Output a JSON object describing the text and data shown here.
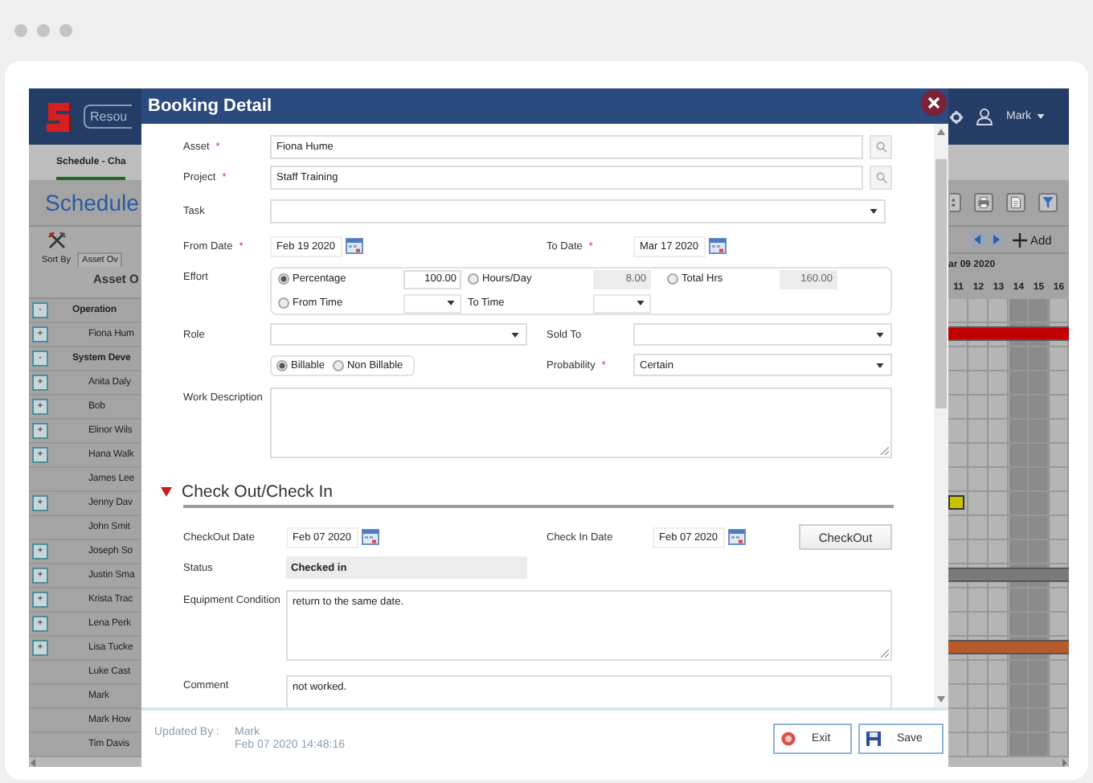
{
  "app": {
    "resource_button": "Resou",
    "user": "Mark"
  },
  "page_tab": {
    "label": "Schedule - Cha",
    "selected": true
  },
  "page_title": "Schedule",
  "grid_header": {
    "sort_label": "Sort By",
    "sort_tab": "Asset Ov",
    "column_heading": "Asset O",
    "add_label": "Add",
    "week": "ar 09 2020"
  },
  "days": [
    {
      "label": "11",
      "weekend": false
    },
    {
      "label": "12",
      "weekend": false
    },
    {
      "label": "13",
      "weekend": false
    },
    {
      "label": "14",
      "weekend": true
    },
    {
      "label": "15",
      "weekend": true
    },
    {
      "label": "16",
      "weekend": false
    }
  ],
  "rows": [
    {
      "kind": "group",
      "toggle": "-",
      "name": "Operation"
    },
    {
      "kind": "asset",
      "toggle": "+",
      "name": "Fiona Hum",
      "bar": {
        "kind": "span",
        "color": "#c00000"
      }
    },
    {
      "kind": "group",
      "toggle": "-",
      "name": "System Deve"
    },
    {
      "kind": "asset",
      "toggle": "+",
      "name": "Anita Daly"
    },
    {
      "kind": "asset",
      "toggle": "+",
      "name": "Bob"
    },
    {
      "kind": "asset",
      "toggle": "+",
      "name": "Elinor Wils"
    },
    {
      "kind": "asset",
      "toggle": "+",
      "name": "Hana Walk"
    },
    {
      "kind": "asset",
      "name": "James Lee"
    },
    {
      "kind": "asset",
      "toggle": "+",
      "name": "Jenny Dav",
      "bar": {
        "kind": "marker",
        "color": "#c8c400"
      }
    },
    {
      "kind": "asset",
      "name": "John Smit"
    },
    {
      "kind": "asset",
      "toggle": "+",
      "name": "Joseph So"
    },
    {
      "kind": "asset",
      "toggle": "+",
      "name": "Justin Sma",
      "bar": {
        "kind": "span",
        "color": "#7a7a7a"
      }
    },
    {
      "kind": "asset",
      "toggle": "+",
      "name": "Krista Trac"
    },
    {
      "kind": "asset",
      "toggle": "+",
      "name": "Lena Perk"
    },
    {
      "kind": "asset",
      "toggle": "+",
      "name": "Lisa Tucke",
      "bar": {
        "kind": "span",
        "color": "#b85a2a"
      }
    },
    {
      "kind": "asset",
      "name": "Luke Cast"
    },
    {
      "kind": "asset",
      "name": "Mark"
    },
    {
      "kind": "asset",
      "name": "Mark How"
    },
    {
      "kind": "asset",
      "name": "Tim Davis"
    }
  ],
  "booking": {
    "title": "Booking Detail",
    "asset": {
      "label": "Asset",
      "mark": "*",
      "value": "Fiona Hume"
    },
    "project": {
      "label": "Project",
      "mark": "*",
      "value": "Staff Training"
    },
    "task": {
      "label": "Task"
    },
    "from_date": {
      "label": "From Date",
      "mark": "*",
      "value": "Feb 19 2020"
    },
    "to_date": {
      "label": "To Date",
      "mark": "*",
      "value": "Mar 17 2020"
    },
    "effort": {
      "label": "Effort",
      "options": [
        {
          "label": "Percentage",
          "selected": true,
          "value": "100.00"
        },
        {
          "label": "Hours/Day",
          "selected": false,
          "value": "8.00"
        },
        {
          "label": "Total Hrs",
          "selected": false,
          "value": "160.00"
        }
      ],
      "from_time": {
        "label": "From Time",
        "selected": false
      },
      "to_time_label": "To Time"
    },
    "role": {
      "label": "Role"
    },
    "sold_to": {
      "label": "Sold To"
    },
    "billing": [
      {
        "label": "Billable",
        "selected": true
      },
      {
        "label": "Non Billable",
        "selected": false
      }
    ],
    "probability": {
      "label": "Probability",
      "mark": "*",
      "value": "Certain"
    },
    "work_description": {
      "label": "Work Description"
    },
    "section": {
      "title": "Check Out/Check In",
      "expanded": true
    },
    "checkout_date": {
      "label": "CheckOut Date",
      "value": "Feb 07 2020"
    },
    "checkin_date": {
      "label": "Check In Date",
      "value": "Feb 07 2020"
    },
    "checkout_button": "CheckOut",
    "status": {
      "label": "Status",
      "value": "Checked in"
    },
    "equipment_condition": {
      "label": "Equipment Condition",
      "value": "return to the same date."
    },
    "comment": {
      "label": "Comment",
      "value": "not worked."
    },
    "updated_by": {
      "label": "Updated By :",
      "name": "Mark",
      "time": "Feb 07 2020 14:48:16"
    },
    "buttons": [
      {
        "label": "Exit",
        "kind": "exit"
      },
      {
        "label": "Save",
        "kind": "save"
      }
    ]
  }
}
